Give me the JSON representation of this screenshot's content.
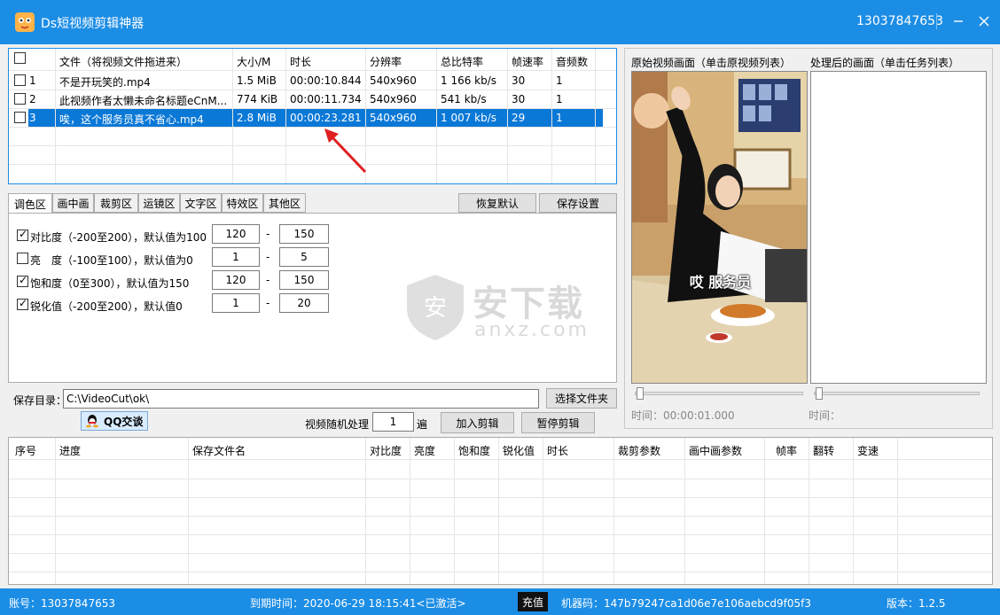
{
  "app": {
    "title": "Ds短视频剪辑神器",
    "account_header": "13037847653"
  },
  "file_table": {
    "headers": [
      "文件（将视频文件拖进来）",
      "大小/M",
      "时长",
      "分辨率",
      "总比特率",
      "帧速率",
      "音频数"
    ],
    "rows": [
      {
        "index": "1",
        "file": "不是开玩笑的.mp4",
        "size": "1.5 MiB",
        "duration": "00:00:10.844",
        "resolution": "540x960",
        "bitrate": "1 166 kb/s",
        "fps": "30",
        "audio": "1"
      },
      {
        "index": "2",
        "file": "此视频作者太懒未命名标题eCnM...",
        "size": "774 KiB",
        "duration": "00:00:11.734",
        "resolution": "540x960",
        "bitrate": "541 kb/s",
        "fps": "30",
        "audio": "1"
      },
      {
        "index": "3",
        "file": "唉，这个服务员真不省心.mp4",
        "size": "2.8 MiB",
        "duration": "00:00:23.281",
        "resolution": "540x960",
        "bitrate": "1 007 kb/s",
        "fps": "29",
        "audio": "1"
      }
    ]
  },
  "tabs": [
    "调色区",
    "画中画",
    "裁剪区",
    "运镜区",
    "文字区",
    "特效区",
    "其他区"
  ],
  "buttons": {
    "restore_default": "恢复默认",
    "save_settings": "保存设置",
    "choose_folder": "选择文件夹",
    "qq_chat": "QQ交谈",
    "add_edit": "加入剪辑",
    "pause_edit": "暂停剪辑"
  },
  "color_settings": [
    {
      "label": "对比度（-200至200），默认值为100",
      "checked": true,
      "min": "120",
      "max": "150"
    },
    {
      "label": "亮　度（-100至100），默认值为0",
      "checked": false,
      "min": "1",
      "max": "5"
    },
    {
      "label": "饱和度（0至300），默认值为150",
      "checked": true,
      "min": "120",
      "max": "150"
    },
    {
      "label": "锐化值（-200至200），默认值0",
      "checked": true,
      "min": "1",
      "max": "20"
    }
  ],
  "range_separator": "-",
  "save_dir": {
    "label": "保存目录：",
    "value": "C:\\VideoCut\\ok\\"
  },
  "random_process": {
    "label": "视频随机处理",
    "value": "1",
    "unit": "遍"
  },
  "preview": {
    "original_label": "原始视频画面（单击原视频列表）",
    "processed_label": "处理后的画面（单击任务列表）",
    "original_time": "时间：00:00:01.000",
    "processed_time": "时间：",
    "subtitle": "哎 服务员"
  },
  "task_table": {
    "headers": [
      "序号",
      "进度",
      "保存文件名",
      "对比度",
      "亮度",
      "饱和度",
      "锐化值",
      "时长",
      "裁剪参数",
      "画中画参数",
      "帧率",
      "翻转",
      "变速"
    ]
  },
  "watermark": {
    "text": "安下载",
    "subtext": "anxz.com"
  },
  "statusbar": {
    "account": "账号：13037847653",
    "expire": "到期时间：2020-06-29 18:15:41<已激活>",
    "recharge": "充值",
    "machine_code": "机器码：147b79247ca1d06e7e106aebcd9f05f3",
    "version": "版本：1.2.5"
  },
  "colors": {
    "accent": "#1c8de5",
    "selection": "#0a78d7",
    "annotation_arrow": "#e02020"
  }
}
